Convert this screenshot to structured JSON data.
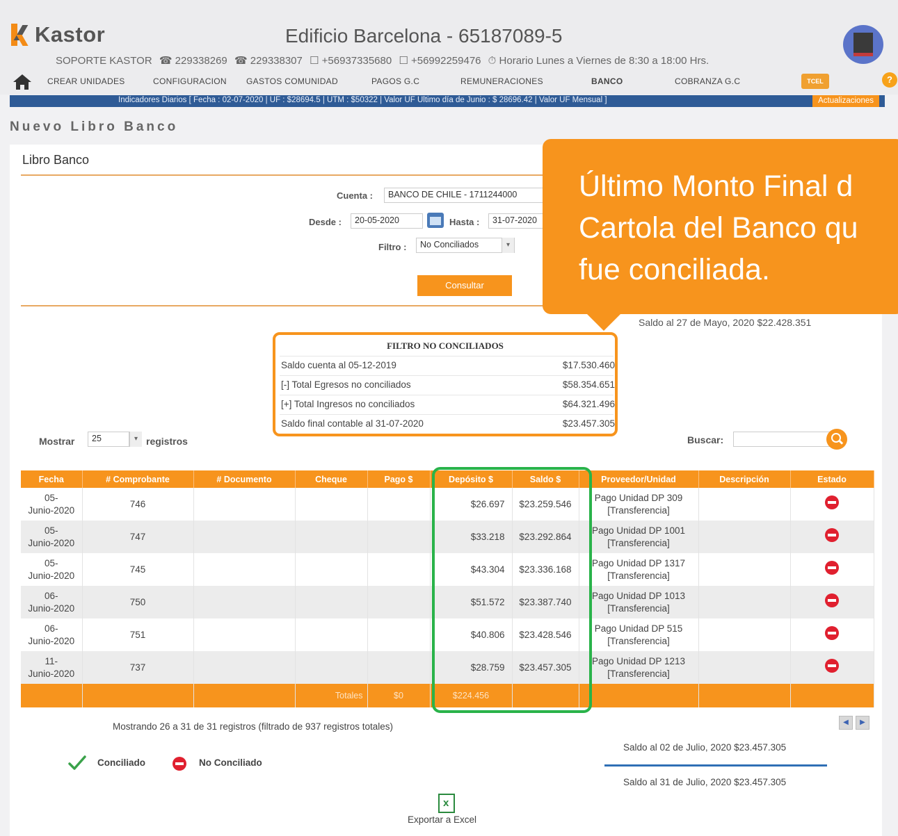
{
  "header": {
    "brand": "Kastor",
    "building": "Edificio Barcelona - 65187089-5",
    "support": [
      "SOPORTE KASTOR",
      "☎ 229338269",
      "☎ 229338307",
      "☐ +56937335680",
      "☐ +56992259476",
      "⏱ Horario Lunes a Viernes de 8:30 a 18:00 Hrs."
    ]
  },
  "nav": {
    "items": [
      "CREAR UNIDADES",
      "CONFIGURACION",
      "GASTOS COMUNIDAD",
      "PAGOS G.C",
      "REMUNERACIONES",
      "BANCO",
      "COBRANZA G.C"
    ],
    "tcel": "TCEL",
    "help": "?"
  },
  "indicators": {
    "text": "Indicadores Diarios [ Fecha : 02-07-2020 | UF : $28694.5 | UTM : $50322 | Valor UF Ultimo día de Junio : $ 28696.42 | Valor UF Mensual ]",
    "button": "Actualizaciones"
  },
  "page_title": "Nuevo Libro Banco",
  "panel_title": "Libro Banco",
  "form": {
    "cuenta_label": "Cuenta :",
    "cuenta_value": "BANCO DE CHILE - 1711244000",
    "desde_label": "Desde :",
    "desde_value": "20-05-2020",
    "hasta_label": "Hasta :",
    "hasta_value": "31-07-2020",
    "filtro_label": "Filtro :",
    "filtro_value": "No Conciliados",
    "consultar": "Consultar"
  },
  "saldo_top": "Saldo al 27 de Mayo, 2020 $22.428.351",
  "filter_summary": {
    "title": "FILTRO NO CONCILIADOS",
    "rows": [
      {
        "label": "Saldo cuenta al 05-12-2019",
        "value": "$17.530.460"
      },
      {
        "label": "[-] Total Egresos no conciliados",
        "value": "$58.354.651"
      },
      {
        "label": "[+] Total Ingresos no conciliados",
        "value": "$64.321.496"
      },
      {
        "label": "Saldo final contable al 31-07-2020",
        "value": "$23.457.305"
      }
    ]
  },
  "controls": {
    "mostrar": "Mostrar",
    "mostrar_value": "25",
    "registros": "registros",
    "buscar": "Buscar:"
  },
  "table": {
    "headers": [
      "Fecha",
      "# Comprobante",
      "# Documento",
      "Cheque",
      "Pago $",
      "Depósito $",
      "Saldo $",
      "Proveedor/Unidad",
      "Descripción",
      "Estado"
    ],
    "rows": [
      {
        "fecha1": "05-",
        "fecha2": "Junio-2020",
        "comp": "746",
        "doc": "",
        "cheque": "",
        "pago": "",
        "deposito": "$26.697",
        "saldo": "$23.259.546",
        "prov1": "Pago Unidad DP 309",
        "prov2": "[Transferencia]",
        "desc": ""
      },
      {
        "fecha1": "05-",
        "fecha2": "Junio-2020",
        "comp": "747",
        "doc": "",
        "cheque": "",
        "pago": "",
        "deposito": "$33.218",
        "saldo": "$23.292.864",
        "prov1": "Pago Unidad DP 1001",
        "prov2": "[Transferencia]",
        "desc": ""
      },
      {
        "fecha1": "05-",
        "fecha2": "Junio-2020",
        "comp": "745",
        "doc": "",
        "cheque": "",
        "pago": "",
        "deposito": "$43.304",
        "saldo": "$23.336.168",
        "prov1": "Pago Unidad DP 1317",
        "prov2": "[Transferencia]",
        "desc": ""
      },
      {
        "fecha1": "06-",
        "fecha2": "Junio-2020",
        "comp": "750",
        "doc": "",
        "cheque": "",
        "pago": "",
        "deposito": "$51.572",
        "saldo": "$23.387.740",
        "prov1": "Pago Unidad DP 1013",
        "prov2": "[Transferencia]",
        "desc": ""
      },
      {
        "fecha1": "06-",
        "fecha2": "Junio-2020",
        "comp": "751",
        "doc": "",
        "cheque": "",
        "pago": "",
        "deposito": "$40.806",
        "saldo": "$23.428.546",
        "prov1": "Pago Unidad DP 515",
        "prov2": "[Transferencia]",
        "desc": ""
      },
      {
        "fecha1": "11-",
        "fecha2": "Junio-2020",
        "comp": "737",
        "doc": "",
        "cheque": "",
        "pago": "",
        "deposito": "$28.759",
        "saldo": "$23.457.305",
        "prov1": "Pago Unidad DP 1213",
        "prov2": "[Transferencia]",
        "desc": ""
      }
    ],
    "totals_label": "Totales",
    "totals_pago": "$0",
    "totals_deposito": "$224.456"
  },
  "pager": {
    "info": "Mostrando 26 a 31 de 31 registros (filtrado de 937 registros totales)"
  },
  "saldos_bottom": {
    "saldo1": "Saldo al 02 de Julio, 2020 $23.457.305",
    "saldo2": "Saldo al 31 de Julio, 2020 $23.457.305"
  },
  "legend": {
    "conciliado": "Conciliado",
    "no_conciliado": "No Conciliado"
  },
  "export": "Exportar a Excel",
  "callout": {
    "text": "Último Monto Final d\nCartola del Banco qu\nfue conciliada."
  },
  "colors": {
    "accent": "#f7941d",
    "navy": "#2f5b96",
    "green": "#2ab34a",
    "red": "#e0202f"
  }
}
